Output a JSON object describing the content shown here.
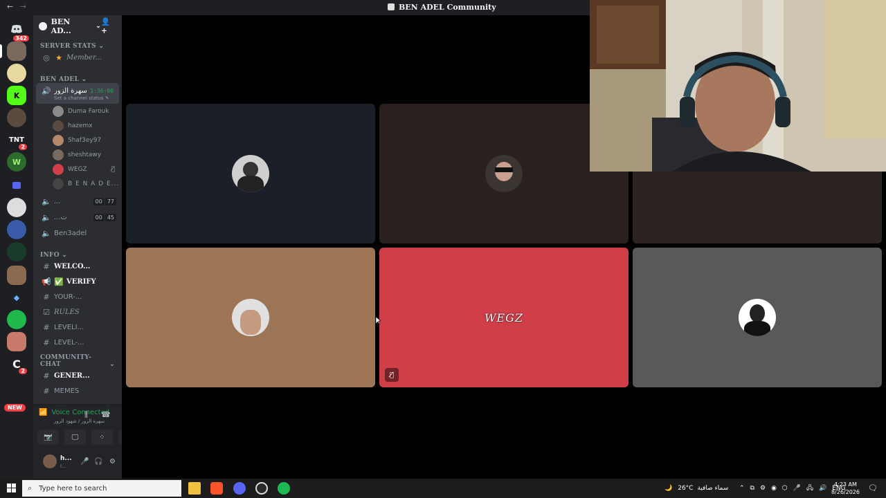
{
  "window": {
    "back": "←",
    "forward": "→",
    "title": "BEN ADEL Community"
  },
  "rail": {
    "home_badge": "342",
    "badge_tnt": "2",
    "tnt_label": "TNT",
    "k_label": "K",
    "w_label": "W",
    "c_badge": "2",
    "new_label": "NEW"
  },
  "server": {
    "name": "BEN AD...",
    "chevron": "⌄",
    "invite_icon": "👤+"
  },
  "categories": {
    "server_stats": "SERVER STATS",
    "ben_adel": "BEN ADEL",
    "info": "INFO",
    "community_chat": "COMMUNITY-CHAT"
  },
  "stats_channel": "Member...",
  "voice_active": {
    "name": "سهرة الزور",
    "timer": "1:36:00",
    "status_hint": "Set a channel status"
  },
  "members": [
    {
      "name": "Duma Farouk"
    },
    {
      "name": "hazemx"
    },
    {
      "name": "Shaf3ey97"
    },
    {
      "name": "sheshtawy"
    },
    {
      "name": "WEGZ"
    },
    {
      "name": "B E N A D E..."
    }
  ],
  "voice_channels": [
    {
      "name": "...",
      "count_a": "00",
      "count_b": "77"
    },
    {
      "name": "...ت",
      "count_a": "00",
      "count_b": "45"
    },
    {
      "name": "Ben3adel"
    }
  ],
  "info_channels": [
    {
      "name": "WELCO..."
    },
    {
      "name": "VERIFY"
    },
    {
      "name": "YOUR-..."
    },
    {
      "name": "RULES"
    },
    {
      "name": "LEVELI..."
    },
    {
      "name": "LEVEL-..."
    }
  ],
  "chat_channels": [
    {
      "name": "GENER..."
    },
    {
      "name": "MEMES"
    }
  ],
  "voice_panel": {
    "status": "Voice Connected",
    "sub": "سهرة الزور / شهود الزور"
  },
  "user_panel": {
    "name": "h...",
    "status": "i..."
  },
  "tiles": [
    {
      "color": "#1a1f28"
    },
    {
      "color": "#2a211e"
    },
    {
      "color": "#2c2222"
    },
    {
      "color": "#9b7556"
    },
    {
      "color": "#d03e48",
      "label": "WEGZ"
    },
    {
      "color": "#595959"
    }
  ],
  "taskbar": {
    "search_placeholder": "Type here to search",
    "weather_temp": "26°C",
    "weather_desc": "سماء صافية",
    "lang": "ENG",
    "time": "4:23 AM",
    "date": "8/26/2026"
  }
}
